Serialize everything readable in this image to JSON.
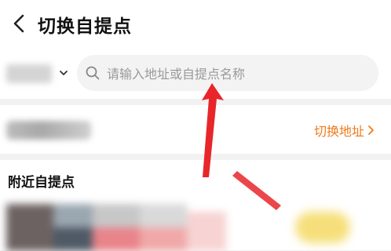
{
  "header": {
    "title": "切换自提点",
    "back_icon": "chevron-left-icon"
  },
  "search": {
    "placeholder": "请输入地址或自提点名称",
    "icon": "search-icon",
    "city_dropdown_icon": "chevron-down-icon"
  },
  "address": {
    "switch_label": "切换地址",
    "switch_icon": "chevron-right-icon"
  },
  "nearby": {
    "title": "附近自提点"
  },
  "colors": {
    "accent_orange": "#f07a1b",
    "annotation_red": "#e8262a",
    "background": "#f2f2f2"
  }
}
